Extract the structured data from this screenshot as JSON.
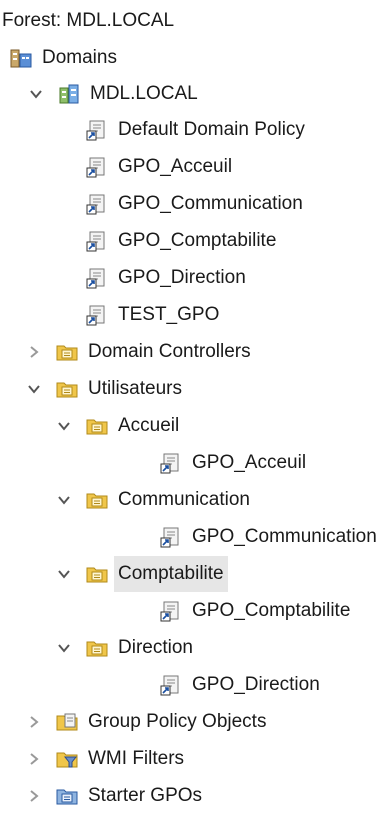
{
  "tree": {
    "forest_label": "Forest: MDL.LOCAL",
    "domains_label": "Domains",
    "domain": "MDL.LOCAL",
    "items": [
      {
        "label": "Default Domain Policy",
        "icon": "gpo-link-icon",
        "chevron": ""
      },
      {
        "label": "GPO_Acceuil",
        "icon": "gpo-link-icon",
        "chevron": ""
      },
      {
        "label": "GPO_Communication",
        "icon": "gpo-link-icon",
        "chevron": ""
      },
      {
        "label": "GPO_Comptabilite",
        "icon": "gpo-link-icon",
        "chevron": ""
      },
      {
        "label": "GPO_Direction",
        "icon": "gpo-link-icon",
        "chevron": ""
      },
      {
        "label": "TEST_GPO",
        "icon": "gpo-link-icon",
        "chevron": ""
      },
      {
        "label": "Domain Controllers",
        "icon": "ou-folder-icon",
        "chevron": "collapsed"
      },
      {
        "label": "Utilisateurs",
        "icon": "ou-folder-icon",
        "chevron": "expanded"
      },
      {
        "label": "Accueil",
        "icon": "ou-folder-icon",
        "chevron": "expanded"
      },
      {
        "label": "GPO_Acceuil",
        "icon": "gpo-link-icon",
        "chevron": ""
      },
      {
        "label": "Communication",
        "icon": "ou-folder-icon",
        "chevron": "expanded"
      },
      {
        "label": "GPO_Communication",
        "icon": "gpo-link-icon",
        "chevron": ""
      },
      {
        "label": "Comptabilite",
        "icon": "ou-folder-icon",
        "chevron": "expanded",
        "selected": true
      },
      {
        "label": "GPO_Comptabilite",
        "icon": "gpo-link-icon",
        "chevron": ""
      },
      {
        "label": "Direction",
        "icon": "ou-folder-icon",
        "chevron": "expanded"
      },
      {
        "label": "GPO_Direction",
        "icon": "gpo-link-icon",
        "chevron": ""
      },
      {
        "label": "Group Policy Objects",
        "icon": "gpo-container-icon",
        "chevron": "collapsed"
      },
      {
        "label": "WMI Filters",
        "icon": "wmi-filter-icon",
        "chevron": "collapsed"
      },
      {
        "label": "Starter GPOs",
        "icon": "starter-gpo-icon",
        "chevron": "collapsed"
      }
    ]
  },
  "colors": {
    "selection": "#e6e6e6",
    "folder": "#f0c64a",
    "chevron": "#555555"
  }
}
